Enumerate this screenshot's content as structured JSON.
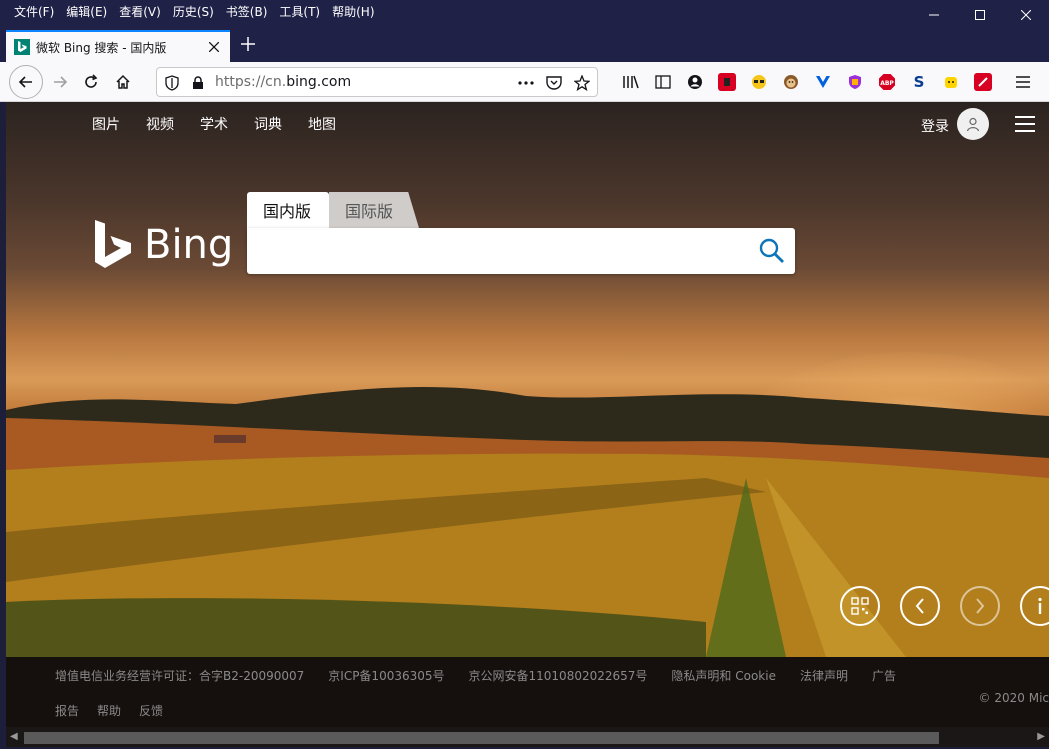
{
  "menubar": {
    "items": [
      "文件(F)",
      "编辑(E)",
      "查看(V)",
      "历史(S)",
      "书签(B)",
      "工具(T)",
      "帮助(H)"
    ]
  },
  "tab": {
    "title": "微软 Bing 搜索 - 国内版"
  },
  "urlbar": {
    "scheme": "https://cn.",
    "host": "bing.com"
  },
  "extensions": [
    "library-icon",
    "sidebar-icon",
    "account-icon",
    "red-extension-icon",
    "sunglasses-extension-icon",
    "monkey-extension-icon",
    "vue-extension-icon",
    "shield-extension-icon",
    "adblock-plus-icon",
    "s-extension-icon",
    "yellow-extension-icon",
    "red-tool-extension-icon",
    "menu-icon"
  ],
  "page": {
    "nav": [
      "图片",
      "视频",
      "学术",
      "词典",
      "地图"
    ],
    "signin": "登录",
    "logo_text": "Bing",
    "search_tabs": {
      "active": "国内版",
      "inactive": "国际版"
    },
    "search": {
      "value": ""
    },
    "footer": {
      "row1": [
        "增值电信业务经营许可证：合字B2-20090007",
        "京ICP备10036305号",
        "京公网安备11010802022657号",
        "隐私声明和 Cookie",
        "法律声明",
        "广告"
      ],
      "row2": [
        "报告",
        "帮助",
        "反馈"
      ],
      "copyright": "© 2020 Mic"
    }
  }
}
